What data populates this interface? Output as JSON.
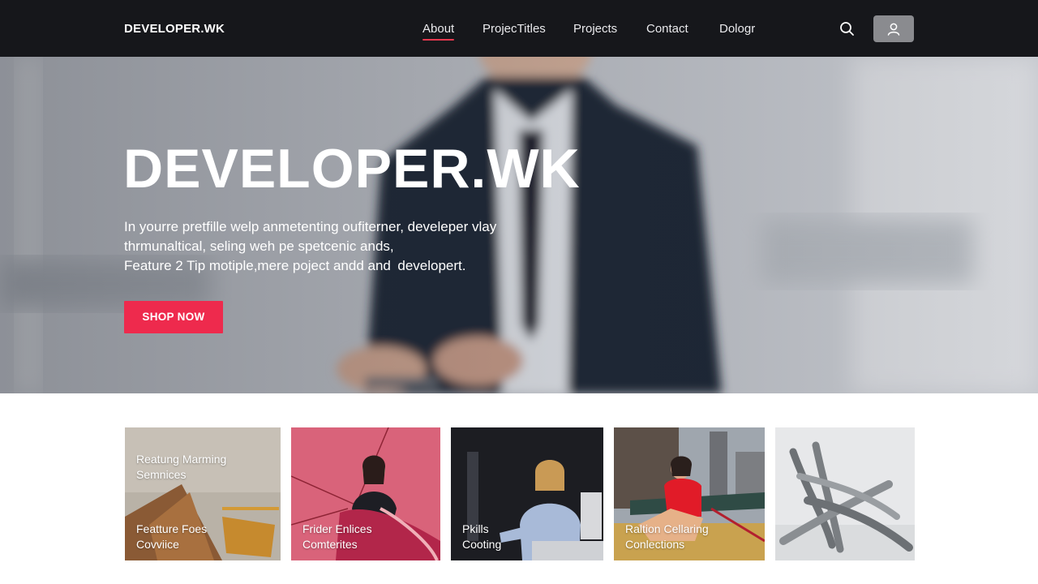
{
  "nav": {
    "brand": "DEVELOPER.WK",
    "items": [
      {
        "label": "About",
        "active": true
      },
      {
        "label": "ProjecTitles",
        "active": false
      },
      {
        "label": "Projects",
        "active": false
      },
      {
        "label": "Contact",
        "active": false
      },
      {
        "label": "Dologr",
        "active": false
      }
    ],
    "search_icon": "search-icon",
    "user_icon": "user-icon"
  },
  "hero": {
    "title": "DEVELOPER.WK",
    "lines": [
      "In yourre pretfille welp anmetenting oufiterner, develeper vlay",
      "thrmunaltical, seling weh pe spetcenic ands,",
      "Feature 2 Tip motiple,mere poject andd and developert."
    ],
    "cta": "SHOP NOW"
  },
  "cards": [
    {
      "top": [
        "Reatung Marming",
        "Semnices"
      ],
      "bottom": [
        "Featture Foes",
        "Covviice"
      ]
    },
    {
      "top": [],
      "bottom": [
        "Frider Enlices",
        "Comterites"
      ]
    },
    {
      "top": [],
      "bottom": [
        "Pkills",
        "Cooting"
      ]
    },
    {
      "top": [],
      "bottom": [
        "Raltion Cellaring",
        "Conlections"
      ]
    },
    {
      "top": [],
      "bottom": []
    }
  ],
  "colors": {
    "nav_bg": "#16171b",
    "accent": "#ee2a4d",
    "active_underline": "#e5394f"
  }
}
